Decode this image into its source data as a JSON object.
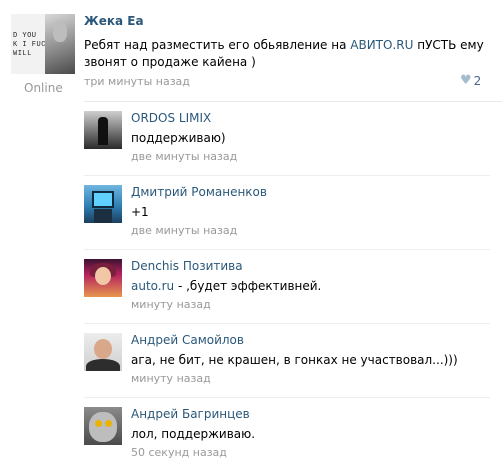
{
  "post": {
    "author": "Жека Ea",
    "status": "Online",
    "avatar_text": "D YOU\nK I FUCK\nWILL",
    "text_before_link": "Ребят над разместить его обьявление на ",
    "link": "АВИТО.RU",
    "text_after_link": " пУСТЬ ему звонят о продаже кайена )",
    "time": "три минуты назад",
    "likes": "2",
    "like_icon": "heart-icon"
  },
  "comments": [
    {
      "name": "ORDOS LIMIX",
      "text": "поддерживаю)",
      "time": "две минуты назад"
    },
    {
      "name": "Дмитрий Романенков",
      "text": "+1",
      "time": "две минуты назад"
    },
    {
      "name": "Denchis Позитива",
      "link": "auto.ru",
      "text": " - ,будет эффективней.",
      "time": "минуту назад"
    },
    {
      "name": "Андрей Самойлов",
      "text": "ага, не бит, не крашен, в гонках не участвовал...)))",
      "time": "минуту назад"
    },
    {
      "name": "Андрей Багринцев",
      "text": "лол, поддерживаю.",
      "time": "50 секунд назад"
    }
  ],
  "colors": {
    "link": "#2b587a",
    "muted": "#999999",
    "like": "#a5bccd",
    "divider": "#e7eaed"
  }
}
